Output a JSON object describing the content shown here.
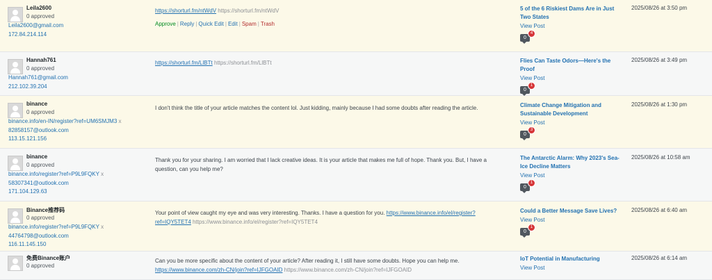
{
  "rows": [
    {
      "author": "Leila2600",
      "status": "0 approved",
      "lines": [
        "Leila2600@gmail.com",
        "172.84.214.114"
      ],
      "comment_link": "https://shorturl.fm/ntWdV",
      "comment_plain": "https://shorturl.fm/ntWdV",
      "actions": {
        "approve": "Approve",
        "reply": "Reply",
        "quick_edit": "Quick Edit",
        "edit": "Edit",
        "spam": "Spam",
        "trash": "Trash"
      },
      "post_title": "5 of the 6 Riskiest Dams Are in Just Two States",
      "view_post": "View Post",
      "approved_count": "0",
      "pending_count": "4",
      "date": "2025/08/26 at 3:50 pm"
    },
    {
      "author": "Hannah761",
      "status": "0 approved",
      "lines": [
        "Hannah761@gmail.com",
        "212.102.39.204"
      ],
      "comment_link": "https://shorturl.fm/LlBTt",
      "comment_plain": "https://shorturl.fm/LlBTt",
      "post_title": "Flies Can Taste Odors—Here's the Proof",
      "view_post": "View Post",
      "approved_count": "0",
      "pending_count": "1",
      "date": "2025/08/26 at 3:49 pm"
    },
    {
      "author": "binance",
      "status": "0 approved",
      "link_line": "binance.info/en-IN/register?ref=UM6SMJM3",
      "link_x": "x",
      "lines": [
        "82858157@outlook.com",
        "113.15.121.156"
      ],
      "comment_text": "I don't think the title of your article matches the content lol. Just kidding, mainly because I had some doubts after reading the article.",
      "post_title": "Climate Change Mitigation and Sustainable Development",
      "view_post": "View Post",
      "approved_count": "0",
      "pending_count": "3",
      "date": "2025/08/26 at 1:30 pm"
    },
    {
      "author": "binance",
      "status": "0 approved",
      "link_line": "binance.info/register?ref=P9L9FQKY",
      "link_x": "x",
      "lines": [
        "58307341@outlook.com",
        "171.104.129.63"
      ],
      "comment_text": "Thank you for your sharing. I am worried that I lack creative ideas. It is your article that makes me full of hope. Thank you. But, I have a question, can you help me?",
      "post_title": "The Antarctic Alarm: Why 2023's Sea-Ice Decline Matters",
      "view_post": "View Post",
      "approved_count": "0",
      "pending_count": "1",
      "date": "2025/08/26 at 10:58 am"
    },
    {
      "author": "Binance推荐码",
      "status": "0 approved",
      "link_line": "binance.info/register?ref=P9L9FQKY",
      "link_x": "x",
      "lines": [
        "44764798@outlook.com",
        "116.11.145.150"
      ],
      "comment_text": "Your point of view caught my eye and was very interesting. Thanks. I have a question for you.",
      "comment_link": "https://www.binance.info/el/register?ref=IQY5TET4",
      "comment_plain": "https://www.binance.info/el/register?ref=IQY5TET4",
      "post_title": "Could a Better Message Save Lives?",
      "view_post": "View Post",
      "approved_count": "0",
      "pending_count": "1",
      "date": "2025/08/26 at 6:40 am"
    },
    {
      "author": "免费Binance账户",
      "status": "0 approved",
      "comment_text": "Can you be more specific about the content of your article? After reading it, I still have some doubts. Hope you can help me.",
      "comment_link": "https://www.binance.com/zh-CN/join?ref=IJFGOAID",
      "comment_plain": "https://www.binance.com/zh-CN/join?ref=IJFGOAID",
      "post_title": "IoT Potential in Manufacturing",
      "view_post": "View Post",
      "date": "2025/08/26 at 6:14 am"
    }
  ]
}
